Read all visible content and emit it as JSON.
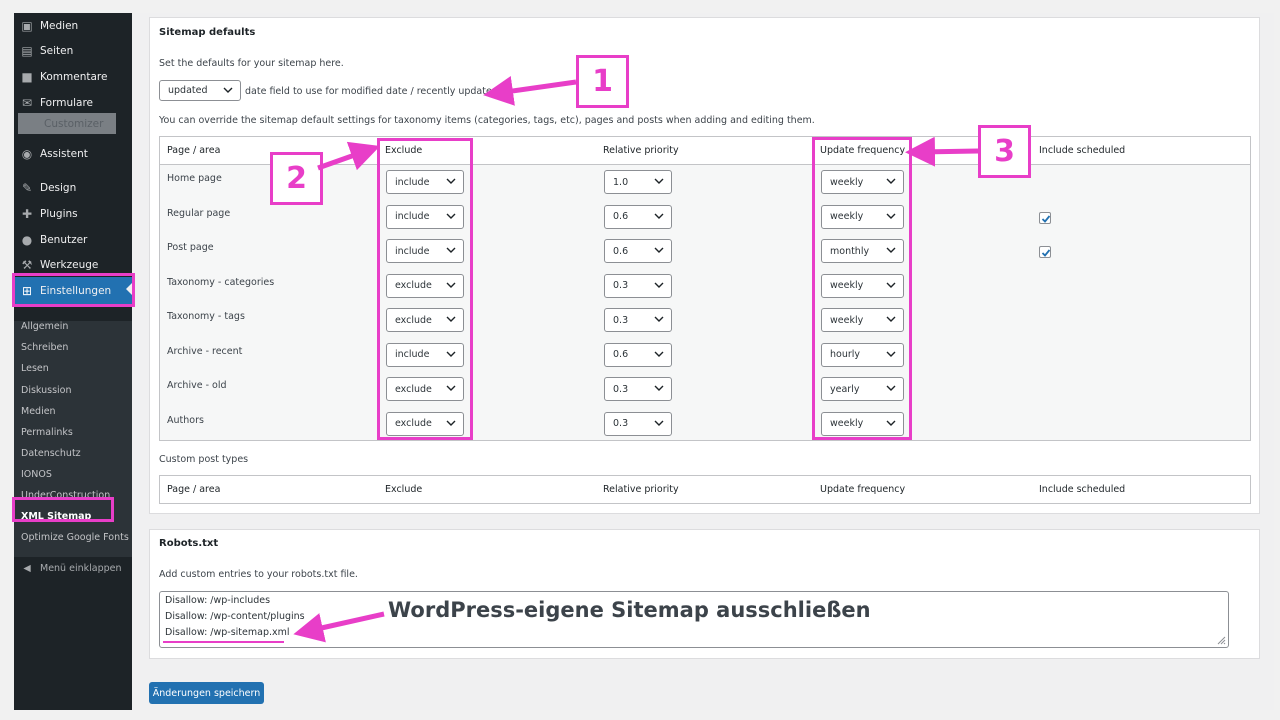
{
  "sidebar": {
    "menu": [
      {
        "label": "Medien",
        "icon": "media-icon"
      },
      {
        "label": "Seiten",
        "icon": "pages-icon"
      },
      {
        "label": "Kommentare",
        "icon": "comments-icon"
      },
      {
        "label": "Formulare",
        "icon": "forms-icon"
      },
      {
        "label": "Customizer",
        "icon": "customizer-icon"
      },
      {
        "label": "Assistent",
        "icon": "assistant-icon"
      },
      {
        "label": "Design",
        "icon": "brush-icon"
      },
      {
        "label": "Plugins",
        "icon": "plugin-icon"
      },
      {
        "label": "Benutzer",
        "icon": "user-icon"
      },
      {
        "label": "Werkzeuge",
        "icon": "wrench-icon"
      },
      {
        "label": "Einstellungen",
        "icon": "settings-icon"
      }
    ],
    "submenu": [
      "Allgemein",
      "Schreiben",
      "Lesen",
      "Diskussion",
      "Medien",
      "Permalinks",
      "Datenschutz",
      "IONOS",
      "UnderConstruction",
      "XML Sitemap",
      "Optimize Google Fonts"
    ],
    "collapse": "Menü einklappen"
  },
  "sitemap": {
    "heading": "Sitemap defaults",
    "intro": "Set the defaults for your sitemap here.",
    "date_field_value": "updated",
    "date_field_note": "date field to use for modified date / recently updated.",
    "override_note": "You can override the sitemap default settings for taxonomy items (categories, tags, etc), pages and posts when adding and editing them.",
    "columns": [
      "Page / area",
      "Exclude",
      "Relative priority",
      "Update frequency",
      "Include scheduled"
    ],
    "rows": [
      {
        "label": "Home page",
        "exclude": "include",
        "priority": "1.0",
        "frequency": "weekly",
        "scheduled": null
      },
      {
        "label": "Regular page",
        "exclude": "include",
        "priority": "0.6",
        "frequency": "weekly",
        "scheduled": true
      },
      {
        "label": "Post page",
        "exclude": "include",
        "priority": "0.6",
        "frequency": "monthly",
        "scheduled": true
      },
      {
        "label": "Taxonomy - categories",
        "exclude": "exclude",
        "priority": "0.3",
        "frequency": "weekly",
        "scheduled": null
      },
      {
        "label": "Taxonomy - tags",
        "exclude": "exclude",
        "priority": "0.3",
        "frequency": "weekly",
        "scheduled": null
      },
      {
        "label": "Archive - recent",
        "exclude": "include",
        "priority": "0.6",
        "frequency": "hourly",
        "scheduled": null
      },
      {
        "label": "Archive - old",
        "exclude": "exclude",
        "priority": "0.3",
        "frequency": "yearly",
        "scheduled": null
      },
      {
        "label": "Authors",
        "exclude": "exclude",
        "priority": "0.3",
        "frequency": "weekly",
        "scheduled": null
      }
    ],
    "custom_heading": "Custom post types",
    "custom_columns": [
      "Page / area",
      "Exclude",
      "Relative priority",
      "Update frequency",
      "Include scheduled"
    ]
  },
  "robots": {
    "heading": "Robots.txt",
    "intro": "Add custom entries to your robots.txt file.",
    "lines": [
      "Disallow: /wp-includes",
      "Disallow: /wp-content/plugins",
      "Disallow: /wp-sitemap.xml"
    ]
  },
  "save_label": "Änderungen speichern",
  "annotations": {
    "numbers": [
      "1",
      "2",
      "3"
    ],
    "caption": "WordPress-eigene Sitemap ausschließen",
    "color": "#e83ec8"
  }
}
